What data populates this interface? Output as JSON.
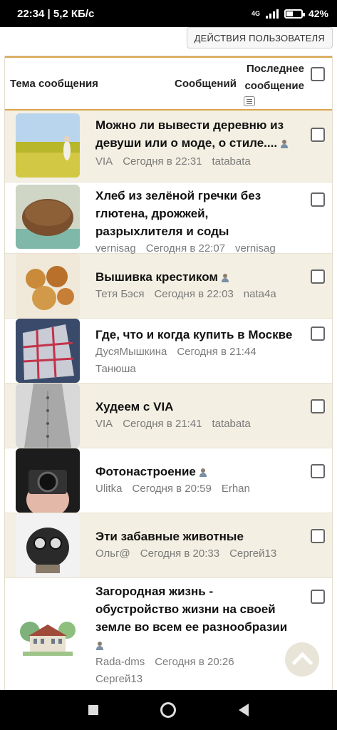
{
  "status_bar": {
    "time_speed": "22:34 | 5,2 КБ/с",
    "network": "4G",
    "battery": "42%"
  },
  "toolbar": {
    "user_actions_label": "ДЕЙСТВИЯ ПОЛЬЗОВАТЕЛЯ"
  },
  "table": {
    "headers": {
      "topic": "Тема сообщения",
      "count": "Сообщений",
      "last_line1": "Последнее",
      "last_line2": "сообщение"
    },
    "rows": [
      {
        "title_lines": [
          "Можно ли вывести деревню из",
          "девуши или о моде, о стиле...."
        ],
        "author": "VIA",
        "date": "Сегодня в 22:31",
        "last_author": "tatabata",
        "thumb": "field-photo"
      },
      {
        "title_lines": [
          "Хлеб из зелёной гречки без",
          "глютена, дрожжей,",
          "разрыхлителя и соды"
        ],
        "author": "vernisag",
        "date": "Сегодня в 22:07",
        "last_author": "vernisag",
        "thumb": "bread-photo"
      },
      {
        "title_lines": [
          "Вышивка крестиком"
        ],
        "author": "Тетя Бэся",
        "date": "Сегодня в 22:03",
        "last_author": "nata4a",
        "thumb": "teddy-photo"
      },
      {
        "title_lines": [
          "Где, что и когда купить в Москве"
        ],
        "author": "ДусяМышкина",
        "date": "Сегодня в 21:44",
        "last_author": "Танюша",
        "thumb": "building-photo"
      },
      {
        "title_lines": [
          "Худеем с VIA"
        ],
        "author": "VIA",
        "date": "Сегодня в 21:41",
        "last_author": "tatabata",
        "thumb": "dress-photo"
      },
      {
        "title_lines": [
          "Фотонастроение"
        ],
        "author": "Ulitka",
        "date": "Сегодня в 20:59",
        "last_author": "Erhan",
        "thumb": "camera-photo"
      },
      {
        "title_lines": [
          "Эти забавные животные"
        ],
        "author": "Ольг@",
        "date": "Сегодня в 20:33",
        "last_author": "Сергей13",
        "thumb": "pug-photo"
      },
      {
        "title_lines": [
          "Загородная жизнь -",
          "обустройство жизни на своей",
          "земле во всем ее разнообразии"
        ],
        "author": "Rada-dms",
        "date": "Сегодня в 20:26",
        "last_author": "Сергей13",
        "thumb": "house-photo"
      }
    ]
  }
}
